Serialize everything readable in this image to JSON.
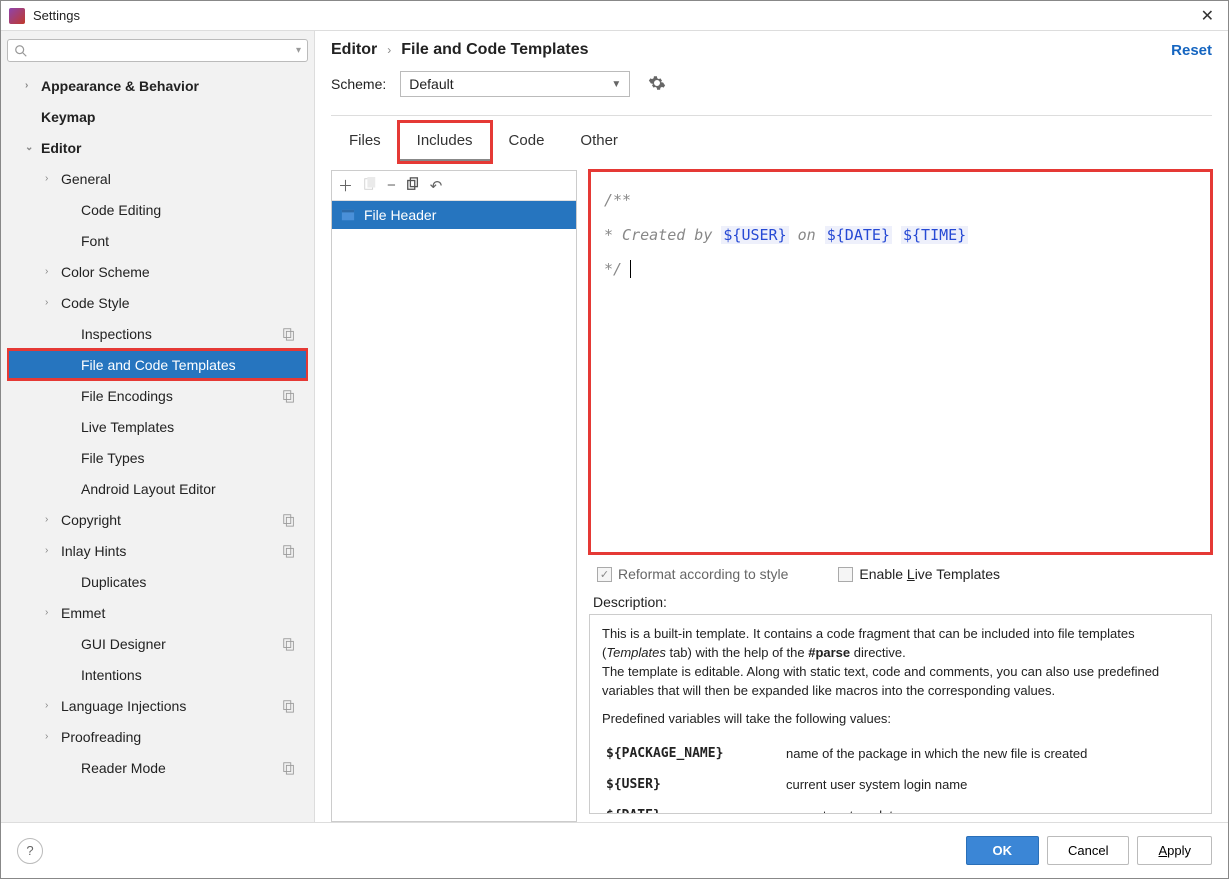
{
  "window": {
    "title": "Settings"
  },
  "sidebar": {
    "search_placeholder": "",
    "items": [
      {
        "label": "Appearance & Behavior",
        "level": 0,
        "chev": "›",
        "bold": true
      },
      {
        "label": "Keymap",
        "level": 0,
        "chev": "",
        "bold": true
      },
      {
        "label": "Editor",
        "level": 0,
        "chev": "⌄",
        "bold": true
      },
      {
        "label": "General",
        "level": 1,
        "chev": "›"
      },
      {
        "label": "Code Editing",
        "level": 2,
        "chev": ""
      },
      {
        "label": "Font",
        "level": 2,
        "chev": ""
      },
      {
        "label": "Color Scheme",
        "level": 1,
        "chev": "›"
      },
      {
        "label": "Code Style",
        "level": 1,
        "chev": "›"
      },
      {
        "label": "Inspections",
        "level": 2,
        "chev": "",
        "badge": true
      },
      {
        "label": "File and Code Templates",
        "level": 2,
        "chev": "",
        "selected": true,
        "highlighted": true
      },
      {
        "label": "File Encodings",
        "level": 2,
        "chev": "",
        "badge": true
      },
      {
        "label": "Live Templates",
        "level": 2,
        "chev": ""
      },
      {
        "label": "File Types",
        "level": 2,
        "chev": ""
      },
      {
        "label": "Android Layout Editor",
        "level": 2,
        "chev": ""
      },
      {
        "label": "Copyright",
        "level": 1,
        "chev": "›",
        "badge": true
      },
      {
        "label": "Inlay Hints",
        "level": 1,
        "chev": "›",
        "badge": true
      },
      {
        "label": "Duplicates",
        "level": 2,
        "chev": ""
      },
      {
        "label": "Emmet",
        "level": 1,
        "chev": "›"
      },
      {
        "label": "GUI Designer",
        "level": 2,
        "chev": "",
        "badge": true
      },
      {
        "label": "Intentions",
        "level": 2,
        "chev": ""
      },
      {
        "label": "Language Injections",
        "level": 1,
        "chev": "›",
        "badge": true
      },
      {
        "label": "Proofreading",
        "level": 1,
        "chev": "›"
      },
      {
        "label": "Reader Mode",
        "level": 2,
        "chev": "",
        "badge": true
      }
    ]
  },
  "header": {
    "crumb1": "Editor",
    "crumb2": "File and Code Templates",
    "reset": "Reset"
  },
  "scheme": {
    "label": "Scheme:",
    "value": "Default"
  },
  "tabs": [
    {
      "label": "Files"
    },
    {
      "label": "Includes",
      "active": true,
      "highlighted": true
    },
    {
      "label": "Code"
    },
    {
      "label": "Other"
    }
  ],
  "filelist": {
    "item": "File Header"
  },
  "editor": {
    "line1": "/**",
    "line2_prefix": " * Created by ",
    "var_user": "${USER}",
    "line2_mid": " on ",
    "var_date": "${DATE}",
    "var_time": "${TIME}",
    "line3": " */"
  },
  "options": {
    "reformat": "Reformat according to style",
    "live_prefix": "Enable ",
    "live_ul": "L",
    "live_rest": "ive Templates"
  },
  "description": {
    "label": "Description:",
    "p1_a": "This is a built-in template. It contains a code fragment that can be included into file templates (",
    "p1_em": "Templates",
    "p1_b": " tab) with the help of the ",
    "p1_bold": "#parse",
    "p1_c": " directive.",
    "p2": "The template is editable. Along with static text, code and comments, you can also use predefined variables that will then be expanded like macros into the corresponding values.",
    "p3": "Predefined variables will take the following values:",
    "vars": [
      {
        "name": "${PACKAGE_NAME}",
        "desc": "name of the package in which the new file is created"
      },
      {
        "name": "${USER}",
        "desc": "current user system login name"
      },
      {
        "name": "${DATE}",
        "desc": "current system date"
      }
    ]
  },
  "footer": {
    "ok": "OK",
    "cancel": "Cancel",
    "apply_ul": "A",
    "apply_rest": "pply"
  }
}
